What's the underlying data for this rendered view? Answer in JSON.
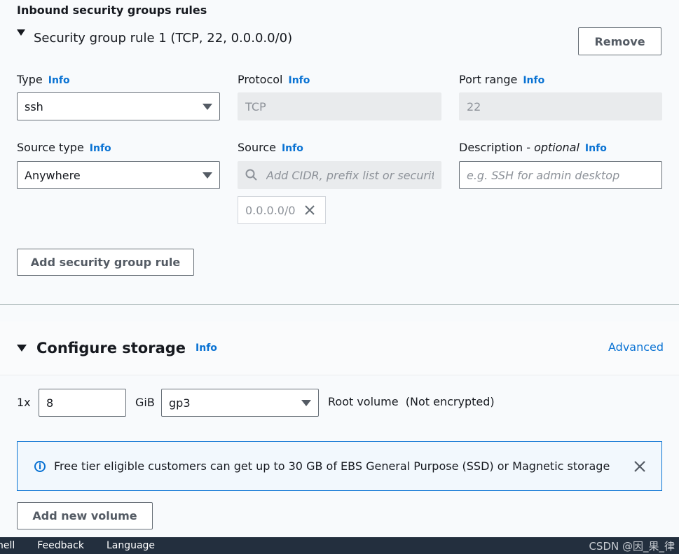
{
  "inbound": {
    "section_title": "Inbound security groups rules",
    "rule_title": "Security group rule 1 (TCP, 22, 0.0.0.0/0)",
    "remove_label": "Remove",
    "type": {
      "label": "Type",
      "info": "Info",
      "value": "ssh"
    },
    "protocol": {
      "label": "Protocol",
      "info": "Info",
      "value": "TCP"
    },
    "port_range": {
      "label": "Port range",
      "info": "Info",
      "value": "22"
    },
    "source_type": {
      "label": "Source type",
      "info": "Info",
      "value": "Anywhere"
    },
    "source": {
      "label": "Source",
      "info": "Info",
      "placeholder": "Add CIDR, prefix list or security",
      "token": "0.0.0.0/0"
    },
    "description": {
      "label": "Description - ",
      "label_optional": "optional",
      "info": "Info",
      "placeholder": "e.g. SSH for admin desktop"
    },
    "add_rule_label": "Add security group rule"
  },
  "storage": {
    "title": "Configure storage",
    "info": "Info",
    "advanced": "Advanced",
    "count": "1x",
    "size": "8",
    "unit": "GiB",
    "volume_type": "gp3",
    "root_volume": "Root volume",
    "encryption": "(Not encrypted)",
    "alert_text": "Free tier eligible customers can get up to 30 GB of EBS General Purpose (SSD) or Magnetic storage",
    "add_volume_label": "Add new volume"
  },
  "footer": {
    "items": [
      "nell",
      "Feedback",
      "Language"
    ],
    "watermark": "CSDN @因_果_律"
  },
  "icons": {
    "caret": "caret-down-icon",
    "dropdown": "dropdown-arrow-icon",
    "search": "search-icon",
    "close": "close-icon",
    "info": "info-circle-icon"
  },
  "colors": {
    "link": "#0972d3",
    "footer_bg": "#232f3e",
    "alert_border": "#0972d3",
    "alert_bg": "#f2f8fd"
  }
}
